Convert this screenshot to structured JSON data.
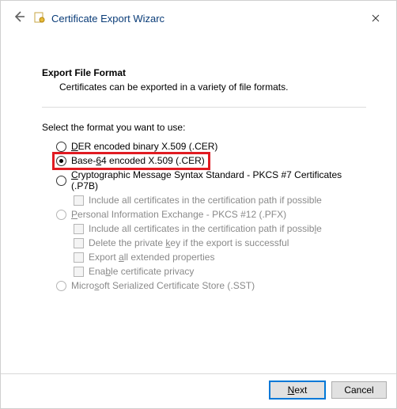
{
  "window": {
    "title": "Certificate Export Wizarc"
  },
  "page": {
    "heading": "Export File Format",
    "subheading": "Certificates can be exported in a variety of file formats.",
    "prompt": "Select the format you want to use:"
  },
  "options": {
    "der": {
      "label_pre": "",
      "key": "D",
      "label_post": "ER encoded binary X.509 (.CER)",
      "checked": false,
      "enabled": true
    },
    "b64": {
      "label_pre": "Base-",
      "key": "6",
      "label_post": "4 encoded X.509 (.CER)",
      "checked": true,
      "enabled": true,
      "highlighted": true
    },
    "pkcs7": {
      "label_pre": "",
      "key": "C",
      "label_post": "ryptographic Message Syntax Standard - PKCS #7 Certificates (.P7B)",
      "checked": false,
      "enabled": true
    },
    "pkcs7_sub": {
      "label": "Include all certificates in the certification path if possible"
    },
    "pfx": {
      "label_pre": "",
      "key": "P",
      "label_post": "ersonal Information Exchange - PKCS #12 (.PFX)",
      "checked": false,
      "enabled": false
    },
    "pfx_sub1": {
      "pre": "Include all certificates in the certification path if possib",
      "key": "l",
      "post": "e"
    },
    "pfx_sub2": {
      "pre": "Delete the private ",
      "key": "k",
      "post": "ey if the export is successful"
    },
    "pfx_sub3": {
      "pre": "Export ",
      "key": "a",
      "post": "ll extended properties"
    },
    "pfx_sub4": {
      "pre": "Ena",
      "key": "b",
      "post": "le certificate privacy"
    },
    "sst": {
      "label_pre": "Micro",
      "key": "s",
      "label_post": "oft Serialized Certificate Store (.SST)",
      "checked": false,
      "enabled": false
    }
  },
  "buttons": {
    "next_pre": "",
    "next_key": "N",
    "next_post": "ext",
    "cancel": "Cancel"
  }
}
